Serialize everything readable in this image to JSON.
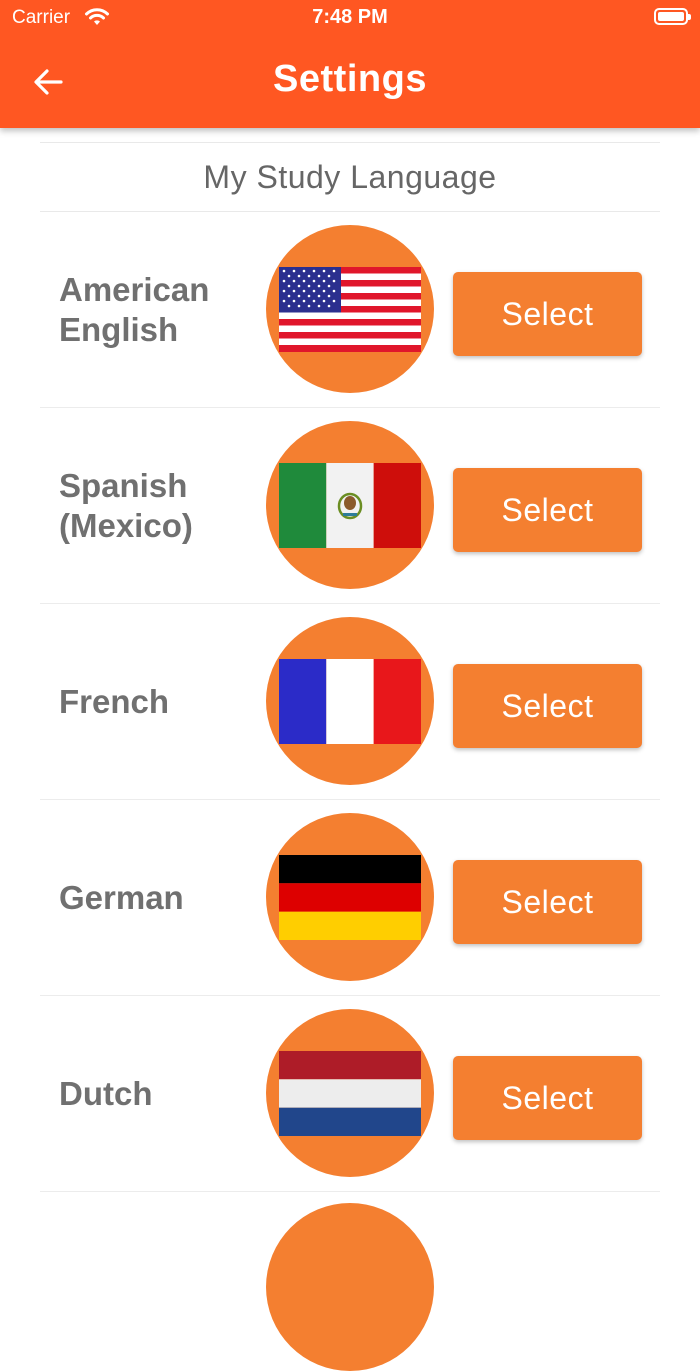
{
  "status_bar": {
    "carrier": "Carrier",
    "time": "7:48 PM"
  },
  "app_bar": {
    "title": "Settings",
    "back_icon": "arrow-left-icon"
  },
  "section": {
    "header": "My Study Language"
  },
  "languages": [
    {
      "name": "American\nEnglish",
      "flag": "us-flag-icon",
      "button": "Select"
    },
    {
      "name": "Spanish\n(Mexico)",
      "flag": "mexico-flag-icon",
      "button": "Select"
    },
    {
      "name": "French",
      "flag": "france-flag-icon",
      "button": "Select"
    },
    {
      "name": "German",
      "flag": "germany-flag-icon",
      "button": "Select"
    },
    {
      "name": "Dutch",
      "flag": "netherlands-flag-icon",
      "button": "Select"
    }
  ],
  "colors": {
    "app_bar": "#FF5722",
    "accent": "#F47F30",
    "label_text": "#707070"
  }
}
